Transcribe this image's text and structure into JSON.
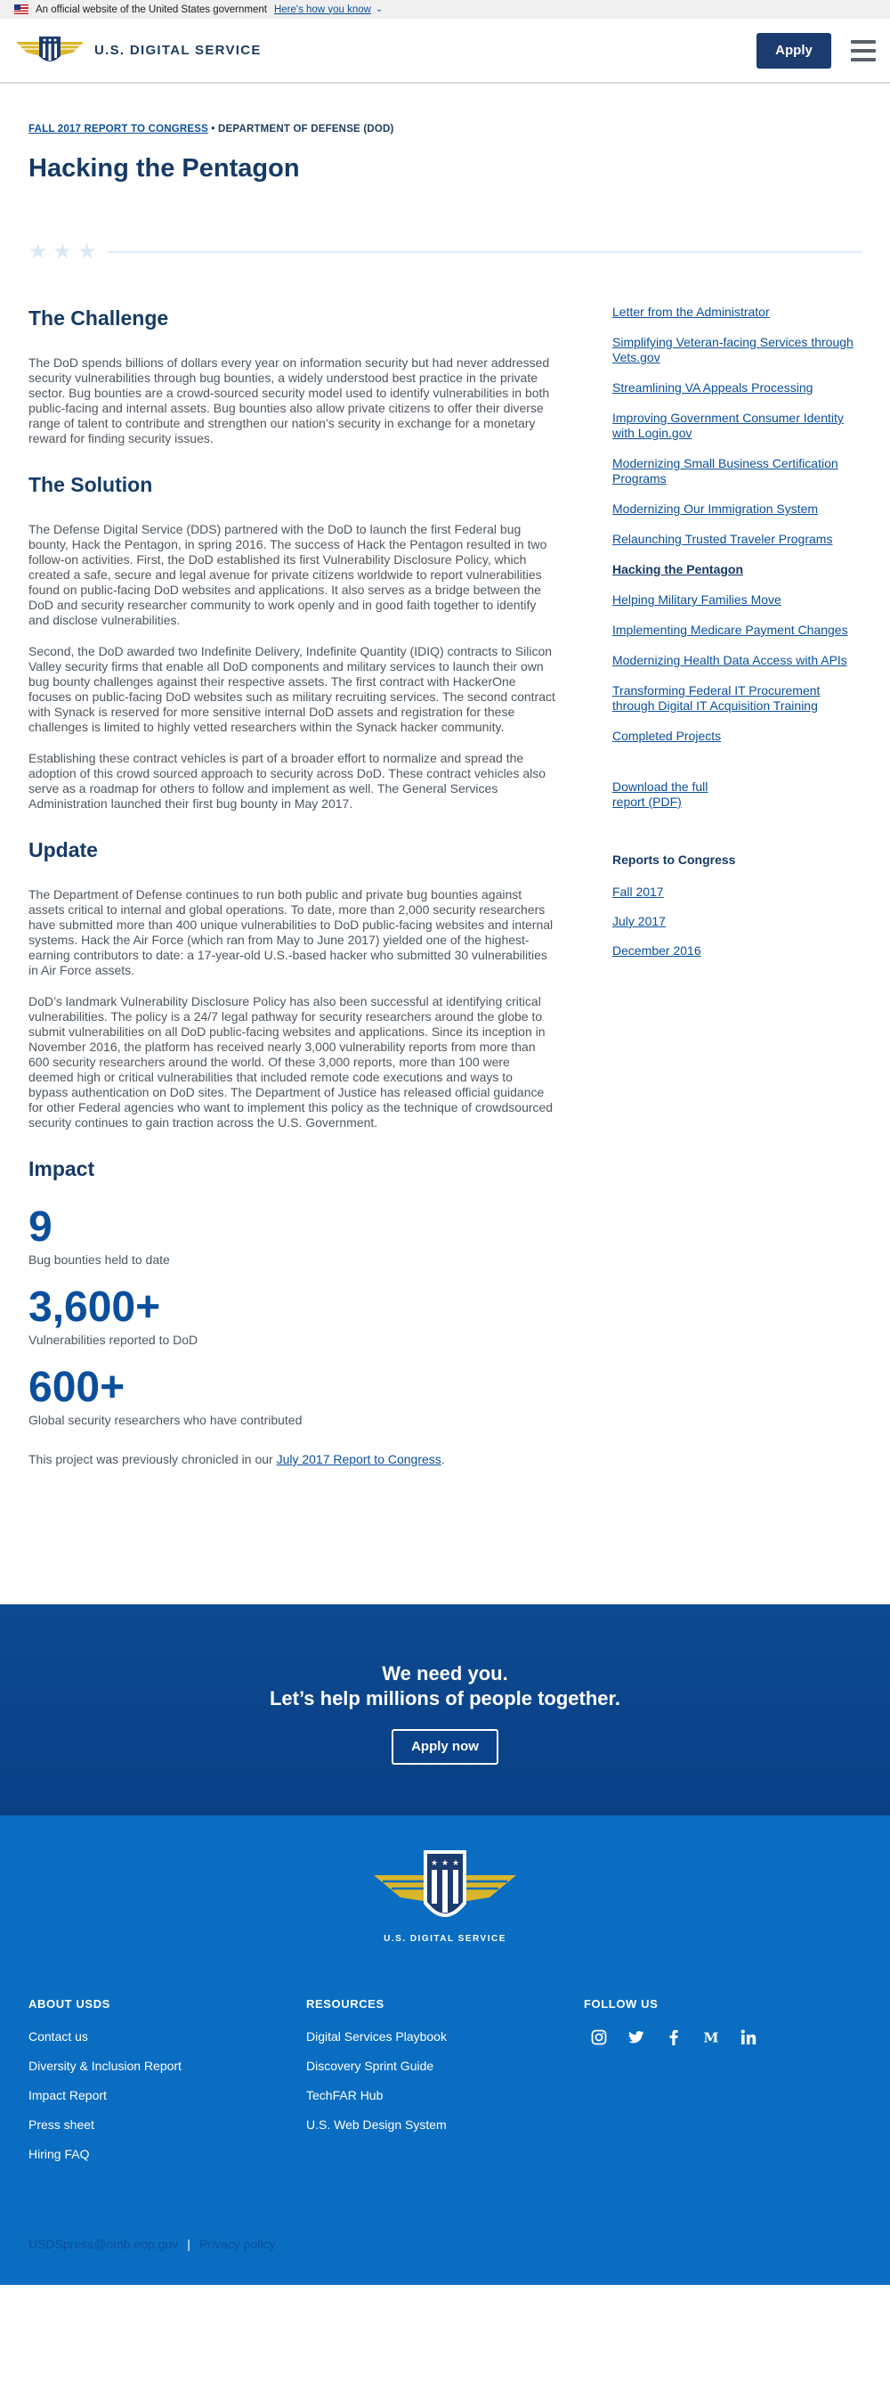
{
  "gov_banner": {
    "text": "An official website of the United States government",
    "link": "Here's how you know"
  },
  "header": {
    "brand": "U.S. DIGITAL SERVICE",
    "apply": "Apply"
  },
  "breadcrumb": {
    "report": "FALL 2017 REPORT TO CONGRESS",
    "separator": "•",
    "department": "DEPARTMENT OF DEFENSE (DOD)"
  },
  "title": "Hacking the Pentagon",
  "sections": {
    "challenge": {
      "heading": "The Challenge",
      "p1": "The DoD spends billions of dollars every year on information security but had never addressed security vulnerabilities through bug bounties, a widely understood best practice in the private sector. Bug bounties are a crowd-sourced security model used to identify vulnerabilities in both public-facing and internal assets. Bug bounties also allow private citizens to offer their diverse range of talent to contribute and strengthen our nation’s security in exchange for a monetary reward for finding security issues."
    },
    "solution": {
      "heading": "The Solution",
      "p1": "The Defense Digital Service (DDS) partnered with the DoD to launch the first Federal bug bounty, Hack the Pentagon, in spring 2016. The success of Hack the Pentagon resulted in two follow-on activities. First, the DoD established its first Vulnerability Disclosure Policy, which created a safe, secure and legal avenue for private citizens worldwide to report vulnerabilities found on public-facing DoD websites and applications. It also serves as a bridge between the DoD and security researcher community to work openly and in good faith together to identify and disclose vulnerabilities.",
      "p2": "Second, the DoD awarded two Indefinite Delivery, Indefinite Quantity (IDIQ) contracts to Silicon Valley security firms that enable all DoD components and military services to launch their own bug bounty challenges against their respective assets. The first contract with HackerOne focuses on public-facing DoD websites such as military recruiting services. The second contract with Synack is reserved for more sensitive internal DoD assets and registration for these challenges is limited to highly vetted researchers within the Synack hacker community.",
      "p3": "Establishing these contract vehicles is part of a broader effort to normalize and spread the adoption of this crowd sourced approach to security across DoD. These contract vehicles also serve as a roadmap for others to follow and implement as well. The General Services Administration launched their first bug bounty in May 2017."
    },
    "update": {
      "heading": "Update",
      "p1": "The Department of Defense continues to run both public and private bug bounties against assets critical to internal and global operations. To date, more than 2,000 security researchers have submitted more than 400 unique vulnerabilities to DoD public-facing websites and internal systems. Hack the Air Force (which ran from May to June 2017) yielded one of the highest-earning contributors to date: a 17-year-old U.S.-based hacker who submitted 30 vulnerabilities in Air Force assets.",
      "p2": "DoD’s landmark Vulnerability Disclosure Policy has also been successful at identifying critical vulnerabilities. The policy is a 24/7 legal pathway for security researchers around the globe to submit vulnerabilities on all DoD public-facing websites and applications. Since its inception in November 2016, the platform has received nearly 3,000 vulnerability reports from more than 600 security researchers around the world. Of these 3,000 reports, more than 100 were deemed high or critical vulnerabilities that included remote code executions and ways to bypass authentication on DoD sites. The Department of Justice has released official guidance for other Federal agencies who want to implement this policy as the technique of crowdsourced security continues to gain traction across the U.S. Government."
    },
    "impact": {
      "heading": "Impact",
      "metrics": [
        {
          "value": "9",
          "label": "Bug bounties held to date"
        },
        {
          "value": "3,600+",
          "label": "Vulnerabilities reported to DoD"
        },
        {
          "value": "600+",
          "label": "Global security researchers who have contributed"
        }
      ],
      "chronicle_prefix": "This project was previously chronicled in our ",
      "chronicle_link": "July 2017 Report to Congress",
      "chronicle_suffix": "."
    }
  },
  "sidebar": {
    "links": [
      "Letter from the Administrator",
      "Simplifying Veteran-facing Services through Vets.gov",
      "Streamlining VA Appeals Processing",
      "Improving Government Consumer Identity with Login.gov",
      "Modernizing Small Business Certification Programs",
      "Modernizing Our Immigration System",
      "Relaunching Trusted Traveler Programs",
      "Hacking the Pentagon",
      "Helping Military Families Move",
      "Implementing Medicare Payment Changes",
      "Modernizing Health Data Access with APIs",
      "Transforming Federal IT Procurement through Digital IT Acquisition Training",
      "Completed Projects"
    ],
    "download": "Download the full report (PDF)",
    "reports_heading": "Reports to Congress",
    "reports": [
      "Fall 2017",
      "July 2017",
      "December 2016"
    ]
  },
  "cta": {
    "line1": "We need you.",
    "line2": "Let’s help millions of people together.",
    "button": "Apply now"
  },
  "footer": {
    "brand": "U.S. DIGITAL SERVICE",
    "about": {
      "heading": "ABOUT USDS",
      "links": [
        "Contact us",
        "Diversity & Inclusion Report",
        "Impact Report",
        "Press sheet",
        "Hiring FAQ"
      ]
    },
    "resources": {
      "heading": "RESOURCES",
      "links": [
        "Digital Services Playbook",
        "Discovery Sprint Guide",
        "TechFAR Hub",
        "U.S. Web Design System"
      ]
    },
    "follow": {
      "heading": "FOLLOW US",
      "icons": [
        "instagram-icon",
        "twitter-icon",
        "facebook-icon",
        "medium-icon",
        "linkedin-icon"
      ]
    },
    "email": "USDSpress@omb.eop.gov",
    "separator": "|",
    "privacy": "Privacy policy"
  },
  "colors": {
    "navy": "#163a66",
    "link": "#0b4f9c",
    "apply_button": "#1c3b6e",
    "cta_bg": "#0d4a91",
    "footer_bg": "#0a6dc1",
    "logo_gold": "#d9b62b"
  }
}
